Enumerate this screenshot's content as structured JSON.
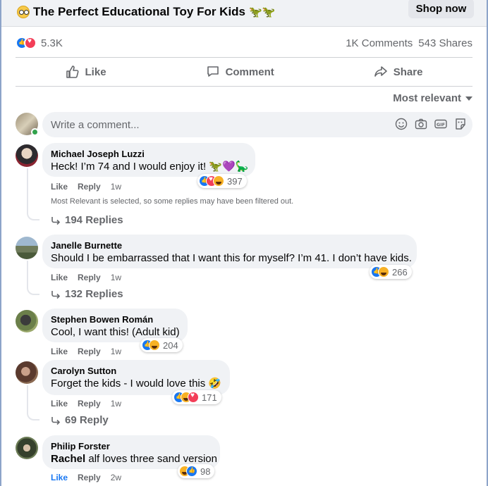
{
  "ad": {
    "title": "The Perfect Educational Toy For Kids",
    "title_emoji_icons": [
      "squinting-face-emoji",
      "dinosaur-emoji",
      "dinosaur-emoji"
    ],
    "shop_label": "Shop now"
  },
  "stats": {
    "reaction_icons": [
      "like",
      "love"
    ],
    "reaction_count": "5.3K",
    "comments": "1K Comments",
    "shares": "543 Shares"
  },
  "actions": {
    "like": "Like",
    "comment": "Comment",
    "share": "Share"
  },
  "sort": {
    "label": "Most relevant"
  },
  "composer": {
    "placeholder": "Write a comment...",
    "icons": [
      "smiley-icon",
      "camera-icon",
      "gif-icon",
      "sticker-icon"
    ]
  },
  "comments": [
    {
      "name": "Michael Joseph Luzzi",
      "text": "Heck! I’m 74 and I would enjoy it! 🦖💜🦕",
      "reactions": [
        "like",
        "love",
        "haha"
      ],
      "reaction_count": "397",
      "like_label": "Like",
      "reply_label": "Reply",
      "time": "1w",
      "filter_note": "Most Relevant is selected, so some replies may have been filtered out.",
      "replies": "194 Replies"
    },
    {
      "name": "Janelle Burnette",
      "text": "Should I be embarrassed that I want this for myself? I’m 41. I don’t have kids.",
      "reactions": [
        "like",
        "haha"
      ],
      "reaction_count": "266",
      "like_label": "Like",
      "reply_label": "Reply",
      "time": "1w",
      "replies": "132 Replies"
    },
    {
      "name": "Stephen Bowen Román",
      "text": "Cool, I want this! (Adult kid)",
      "reactions": [
        "like",
        "haha"
      ],
      "reaction_count": "204",
      "like_label": "Like",
      "reply_label": "Reply",
      "time": "1w"
    },
    {
      "name": "Carolyn Sutton",
      "text": "Forget the kids - I would love this 🤣",
      "reactions": [
        "like",
        "haha",
        "love"
      ],
      "reaction_count": "171",
      "like_label": "Like",
      "reply_label": "Reply",
      "time": "1w",
      "replies": "69 Reply"
    },
    {
      "name": "Philip Forster",
      "text_tag": "Rachel",
      "text_rest": " alf loves three sand version",
      "reactions": [
        "haha",
        "like"
      ],
      "reaction_count": "98",
      "like_label": "Like",
      "reply_label": "Reply",
      "time": "2w",
      "liked": true
    }
  ],
  "colors": {
    "facebook_blue": "#1877f2",
    "love_red": "#f33e58",
    "haha_yellow": "#f7b125",
    "secondary_text": "#65676b",
    "bubble_bg": "#f0f2f5"
  }
}
